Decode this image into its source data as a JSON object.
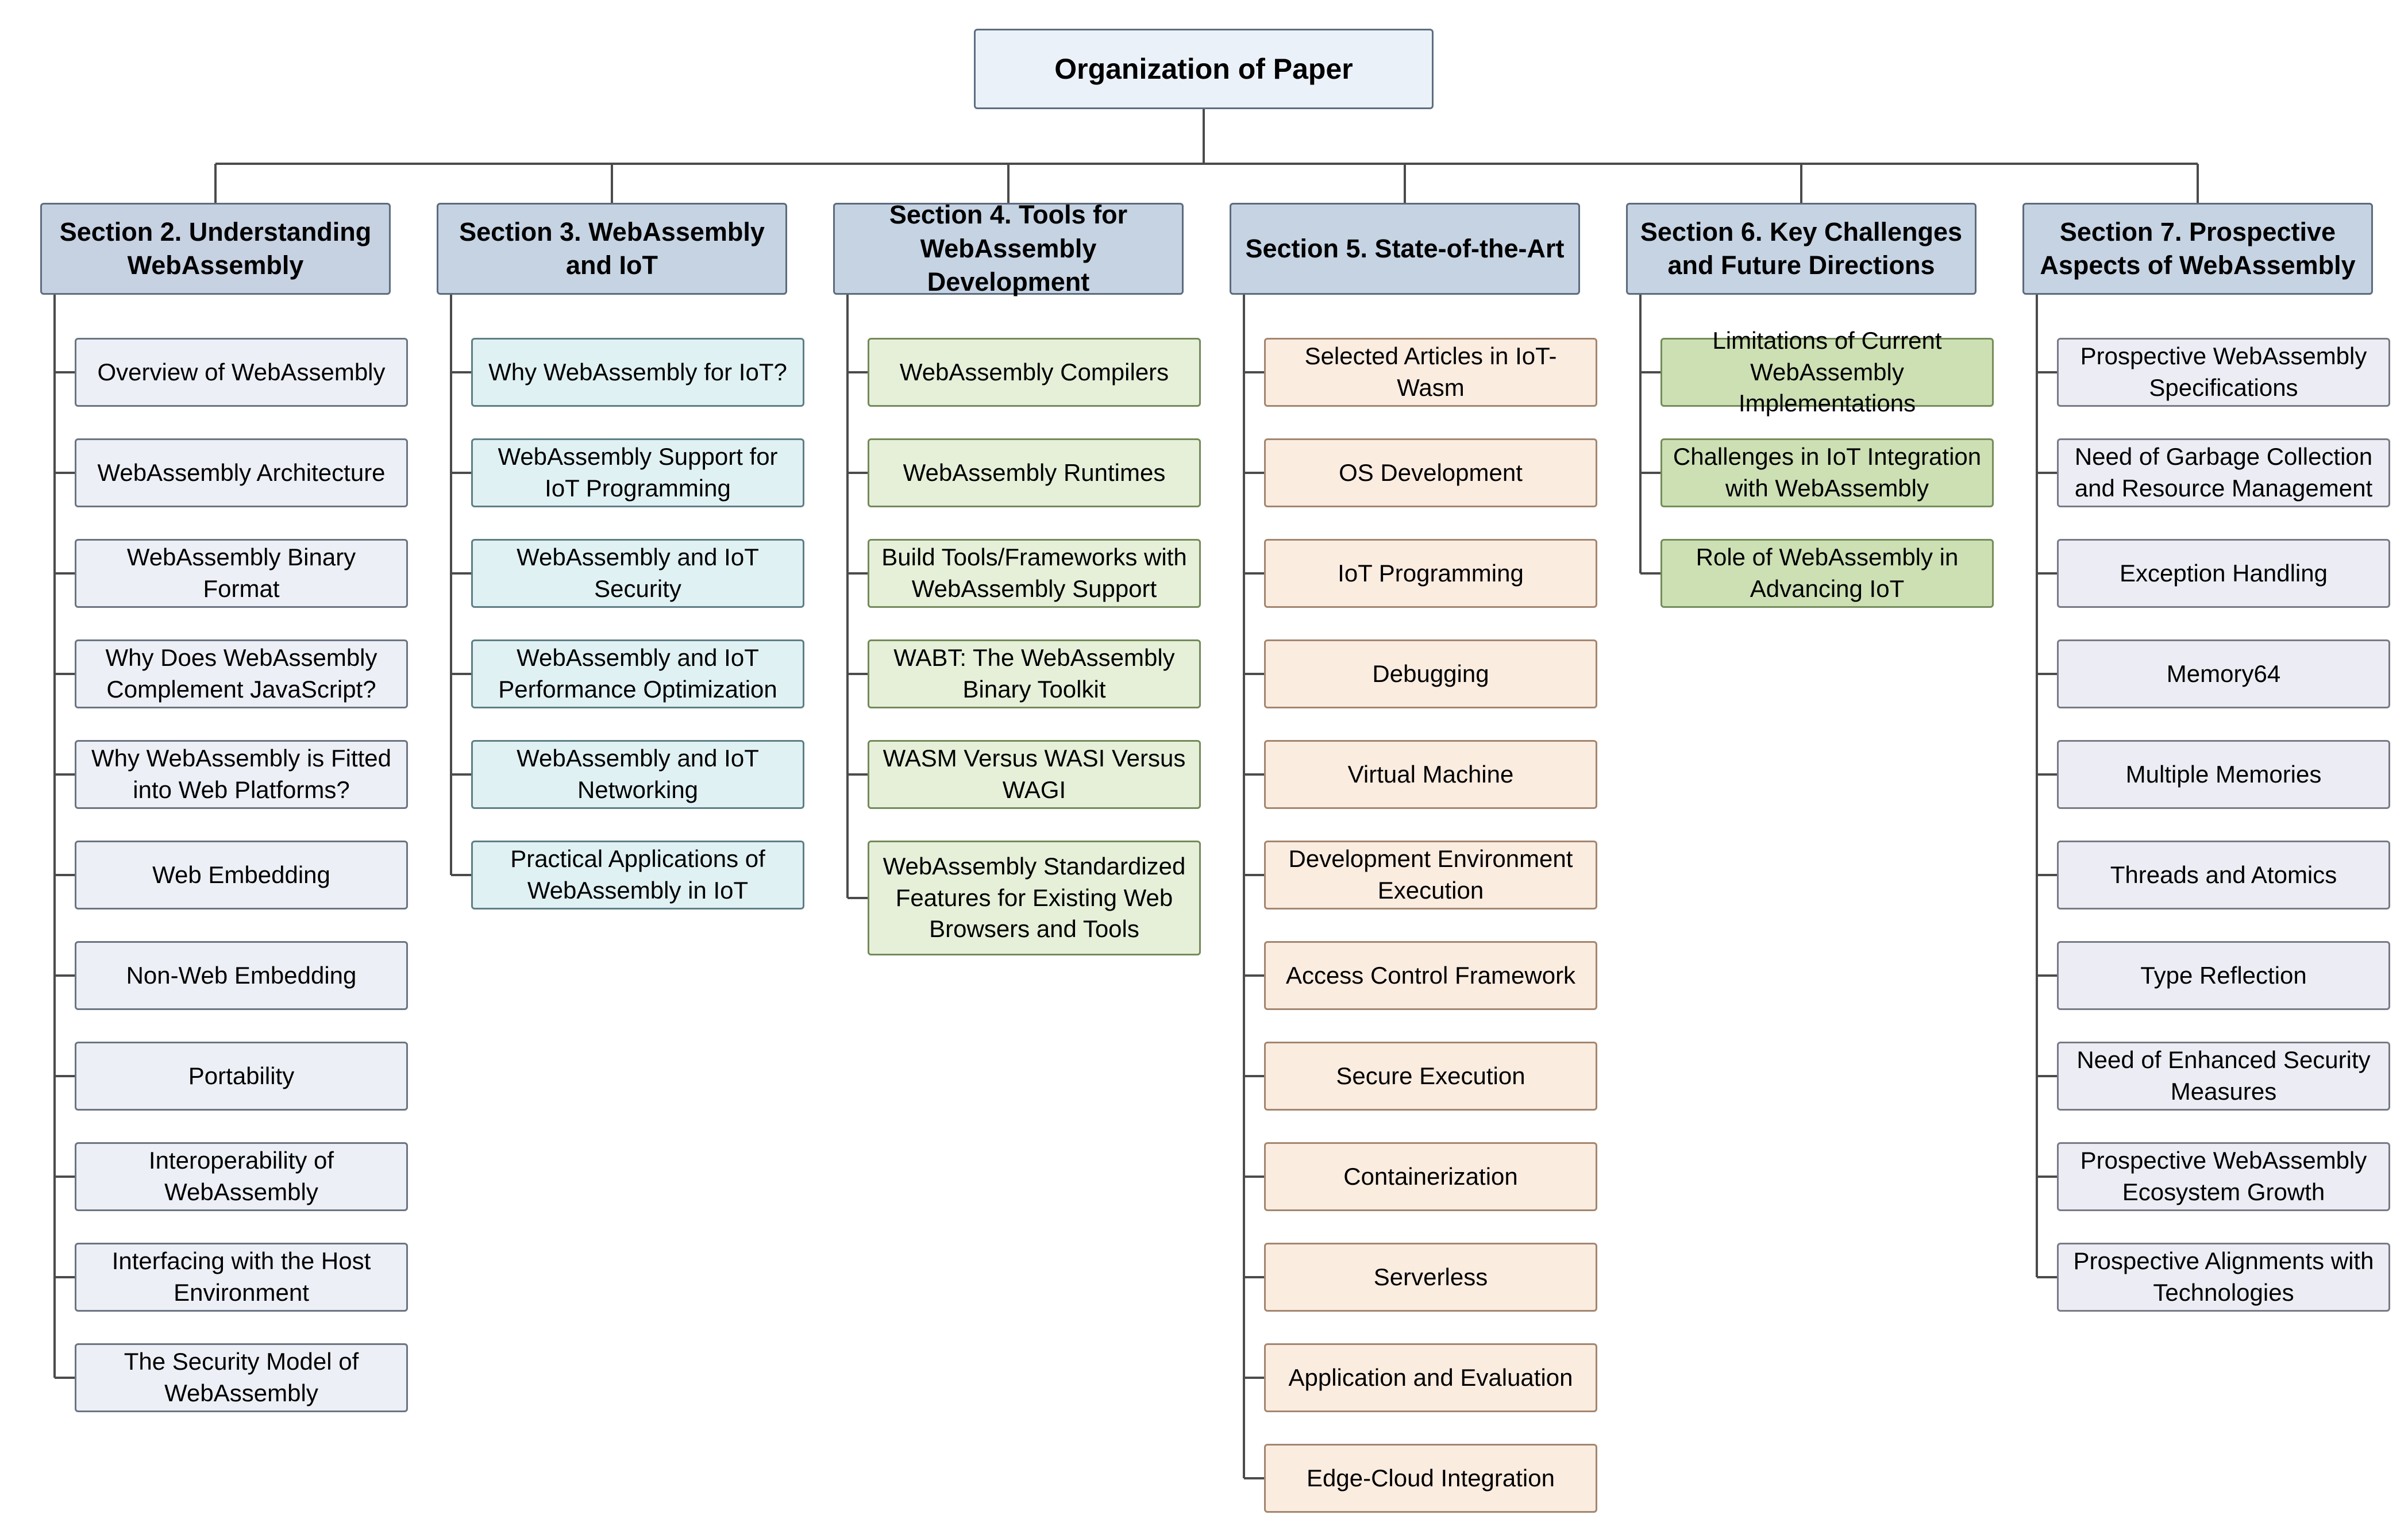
{
  "title": "Organization of Paper",
  "sections": [
    {
      "label": "Section 2. Understanding WebAssembly",
      "bg": "#c6d1e2",
      "border": "#5e6d80",
      "sub_bg": "#eceff5",
      "sub_border": "#6b7482",
      "items": [
        "Overview of WebAssembly",
        "WebAssembly Architecture",
        "WebAssembly Binary Format",
        "Why Does WebAssembly Complement JavaScript?",
        "Why WebAssembly is Fitted into Web Platforms?",
        "Web Embedding",
        "Non-Web Embedding",
        "Portability",
        "Interoperability of WebAssembly",
        "Interfacing with the Host Environment",
        "The Security Model of WebAssembly"
      ]
    },
    {
      "label": "Section 3. WebAssembly and IoT",
      "bg": "#c5d3e3",
      "border": "#5c6b7d",
      "sub_bg": "#e0f1f4",
      "sub_border": "#5e7f85",
      "items": [
        "Why WebAssembly for IoT?",
        "WebAssembly Support for IoT Programming",
        "WebAssembly and IoT Security",
        "WebAssembly and IoT Performance Optimization",
        "WebAssembly and IoT Networking",
        "Practical Applications  of WebAssembly in IoT"
      ]
    },
    {
      "label": "Section 4. Tools for WebAssembly Development",
      "bg": "#c5d3e3",
      "border": "#5c6b7d",
      "sub_bg": "#e6f0d9",
      "sub_border": "#748a5a",
      "items": [
        "WebAssembly Compilers",
        "WebAssembly Runtimes",
        "Build Tools/Frameworks with WebAssembly Support",
        "WABT: The WebAssembly Binary Toolkit",
        "WASM Versus WASI Versus WAGI",
        "WebAssembly Standardized Features for Existing Web Browsers and Tools"
      ]
    },
    {
      "label": "Section 5. State-of-the-Art",
      "bg": "#c5d3e3",
      "border": "#5c6b7d",
      "sub_bg": "#fbece0",
      "sub_border": "#a3866f",
      "items": [
        "Selected Articles in IoT-Wasm",
        "OS Development",
        "IoT Programming",
        "Debugging",
        "Virtual Machine",
        "Development Environment Execution",
        "Access Control Framework",
        "Secure Execution",
        "Containerization",
        "Serverless",
        "Application and Evaluation",
        "Edge-Cloud Integration"
      ]
    },
    {
      "label": "Section 6. Key Challenges and Future Directions",
      "bg": "#c5d3e3",
      "border": "#5c6b7d",
      "sub_bg": "#cde0b4",
      "sub_border": "#748d5a",
      "items": [
        "Limitations of Current WebAssembly Implementations",
        "Challenges in IoT Integration with WebAssembly",
        "Role of WebAssembly in Advancing IoT"
      ]
    },
    {
      "label": "Section 7. Prospective Aspects of WebAssembly",
      "bg": "#c5d3e3",
      "border": "#5c6b7d",
      "sub_bg": "#ecedf4",
      "sub_border": "#787a85",
      "items": [
        "Prospective WebAssembly Specifications",
        "Need of Garbage Collection and Resource Management",
        "Exception Handling",
        "Memory64",
        "Multiple Memories",
        "Threads and Atomics",
        "Type Reflection",
        "Need of Enhanced Security Measures",
        "Prospective WebAssembly Ecosystem Growth",
        "Prospective Alignments with Technologies"
      ]
    }
  ]
}
